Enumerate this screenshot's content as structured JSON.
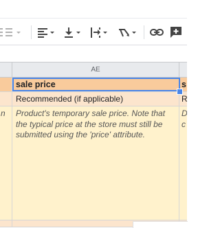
{
  "toolbar": {
    "items": [
      {
        "name": "more-formats-icon",
        "has_dropdown": true
      },
      {
        "name": "horizontal-align-icon",
        "has_dropdown": true
      },
      {
        "name": "vertical-align-icon",
        "has_dropdown": true
      },
      {
        "name": "text-wrapping-icon",
        "has_dropdown": true
      },
      {
        "name": "text-rotation-icon",
        "has_dropdown": true
      },
      {
        "name": "insert-link-icon",
        "has_dropdown": false
      },
      {
        "name": "insert-comment-icon",
        "has_dropdown": false
      }
    ]
  },
  "columns": {
    "ae": "AE"
  },
  "rows": {
    "header": {
      "main": "sale price",
      "next": "s"
    },
    "requirement": {
      "main": "Recommended (if applicable)",
      "next": "R"
    },
    "description": {
      "main": "Product's temporary sale price. Note that the typical price at the store must still be submitted using the 'price' attribute.",
      "next_line1": "D",
      "next_line2": "c",
      "prev_line1": "n"
    }
  },
  "colors": {
    "header_row": "#f9cb9c",
    "requirement_row": "#fce5cd",
    "description_row": "#fff2cc",
    "selection": "#4a86e8"
  }
}
